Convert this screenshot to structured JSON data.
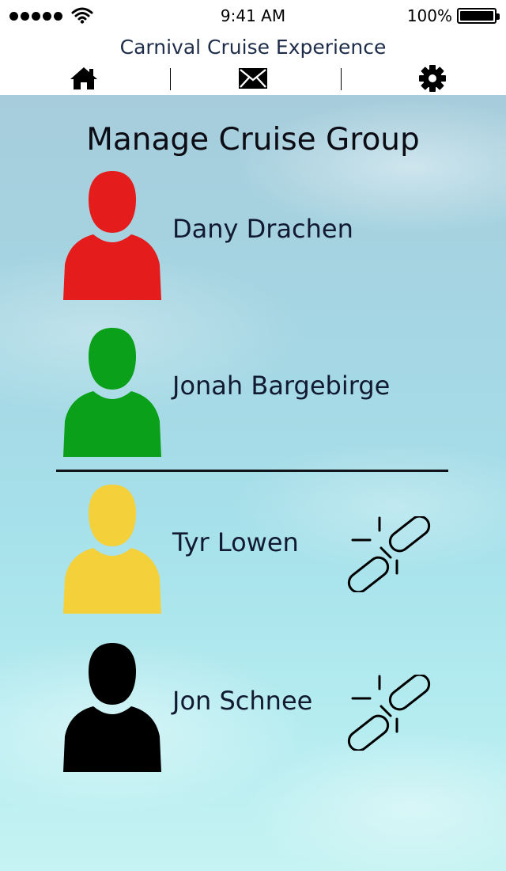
{
  "status_bar": {
    "time": "9:41 AM",
    "battery": "100%"
  },
  "app": {
    "title": "Carnival Cruise Experience"
  },
  "nav": {
    "items": [
      {
        "icon": "home-icon"
      },
      {
        "icon": "mail-icon"
      },
      {
        "icon": "gear-icon"
      }
    ]
  },
  "page": {
    "title": "Manage Cruise Group"
  },
  "members": [
    {
      "name": "Dany Drachen",
      "color": "#e41c1c",
      "unlinkable": false
    },
    {
      "name": "Jonah Bargebirge",
      "color": "#0aa01a",
      "unlinkable": false
    },
    {
      "name": "Tyr Lowen",
      "color": "#f4d03a",
      "unlinkable": true
    },
    {
      "name": "Jon Schnee",
      "color": "#000000",
      "unlinkable": true
    }
  ],
  "icons": {
    "member_action": "unlink-icon"
  }
}
